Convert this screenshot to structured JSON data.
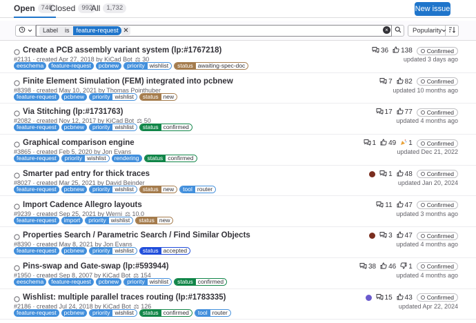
{
  "tabs": [
    {
      "label": "Open",
      "count": "740"
    },
    {
      "label": "Closed",
      "count": "992"
    },
    {
      "label": "All",
      "count": "1,732"
    }
  ],
  "new_issue_label": "New issue",
  "filter": {
    "token_key": "Label",
    "token_op": "is",
    "token_value": "feature-request",
    "sort_label": "Popularity"
  },
  "colors": {
    "blue_label": "#428fdc",
    "brown_label": "#a47b4c",
    "green_label": "#108548",
    "darkblue_label": "#1f4ddb",
    "accent": "#1f75cb"
  },
  "issues": [
    {
      "title": "Create a PCB assembly variant system (lp:#1767218)",
      "meta": "#2131 · created Apr 27, 2018 by KiCad Bot",
      "weight": "30",
      "labels": [
        {
          "k": "eeschema"
        },
        {
          "k": "feature-request"
        },
        {
          "k": "pcbnew"
        },
        {
          "k": "priority",
          "v": "wishlist"
        },
        {
          "k": "status",
          "v": "awaiting-spec-doc",
          "c": "brown"
        }
      ],
      "stats": [
        {
          "icon": "comment",
          "n": "36"
        },
        {
          "icon": "thumbsup",
          "n": "138"
        }
      ],
      "status": "Confirmed",
      "updated": "updated 3 days ago"
    },
    {
      "title": "Finite Element Simulation (FEM) integrated into pcbnew",
      "meta": "#8398 · created May 10, 2021 by Thomas Pointhuber",
      "weight": "",
      "labels": [
        {
          "k": "feature-request"
        },
        {
          "k": "pcbnew"
        },
        {
          "k": "priority",
          "v": "wishlist"
        },
        {
          "k": "status",
          "v": "new",
          "c": "brown"
        }
      ],
      "stats": [
        {
          "icon": "comment",
          "n": "7"
        },
        {
          "icon": "thumbsup",
          "n": "82"
        }
      ],
      "status": "Confirmed",
      "updated": "updated 10 months ago"
    },
    {
      "title": "Via Stitching (lp:#1731763)",
      "meta": "#2082 · created Nov 12, 2017 by KiCad Bot",
      "weight": "50",
      "labels": [
        {
          "k": "feature-request"
        },
        {
          "k": "pcbnew"
        },
        {
          "k": "priority",
          "v": "wishlist"
        },
        {
          "k": "status",
          "v": "confirmed",
          "c": "green"
        }
      ],
      "stats": [
        {
          "icon": "comment",
          "n": "17"
        },
        {
          "icon": "thumbsup",
          "n": "77"
        }
      ],
      "status": "Confirmed",
      "updated": "updated 4 months ago"
    },
    {
      "title": "Graphical comparison engine",
      "meta": "#3865 · created Feb 5, 2020 by Jon Evans",
      "weight": "",
      "labels": [
        {
          "k": "feature-request"
        },
        {
          "k": "priority",
          "v": "wishlist"
        },
        {
          "k": "rendering"
        },
        {
          "k": "status",
          "v": "confirmed",
          "c": "green"
        }
      ],
      "stats": [
        {
          "icon": "comment",
          "n": "1"
        },
        {
          "icon": "thumbsup",
          "n": "49"
        },
        {
          "icon": "tada",
          "n": "1"
        }
      ],
      "status": "Confirmed",
      "updated": "updated Dec 21, 2022"
    },
    {
      "title": "Smarter pad entry for thick traces",
      "meta": "#8027 · created Mar 25, 2021 by David Beinder",
      "weight": "",
      "labels": [
        {
          "k": "feature-request"
        },
        {
          "k": "pcbnew"
        },
        {
          "k": "priority",
          "v": "wishlist"
        },
        {
          "k": "status",
          "v": "new",
          "c": "brown"
        },
        {
          "k": "tool",
          "v": "router"
        }
      ],
      "avatar": "#7a2e1f",
      "stats": [
        {
          "icon": "comment",
          "n": "1"
        },
        {
          "icon": "thumbsup",
          "n": "48"
        }
      ],
      "status": "Confirmed",
      "updated": "updated Jan 20, 2024"
    },
    {
      "title": "Import Cadence Allegro layouts",
      "meta": "#9239 · created Sep 25, 2021 by Werni",
      "weight": "10.0",
      "labels": [
        {
          "k": "feature-request"
        },
        {
          "k": "import"
        },
        {
          "k": "priority",
          "v": "wishlist"
        },
        {
          "k": "status",
          "v": "new",
          "c": "brown"
        }
      ],
      "stats": [
        {
          "icon": "comment",
          "n": "11"
        },
        {
          "icon": "thumbsup",
          "n": "47"
        }
      ],
      "status": "Confirmed",
      "updated": "updated 3 months ago"
    },
    {
      "title": "Properties Search / Parametric Search / Find Similar Objects",
      "meta": "#8390 · created May 8, 2021 by Jon Evans",
      "weight": "",
      "labels": [
        {
          "k": "feature-request"
        },
        {
          "k": "pcbnew"
        },
        {
          "k": "priority",
          "v": "wishlist"
        },
        {
          "k": "status",
          "v": "accepted",
          "c": "darkblue"
        }
      ],
      "avatar": "#7a2e1f",
      "stats": [
        {
          "icon": "comment",
          "n": "3"
        },
        {
          "icon": "thumbsup",
          "n": "47"
        }
      ],
      "status": "Confirmed",
      "updated": "updated 4 months ago"
    },
    {
      "title": "Pins-swap and Gate-swap (lp:#593944)",
      "meta": "#1950 · created Sep 8, 2007 by KiCad Bot",
      "weight": "154",
      "labels": [
        {
          "k": "eeschema"
        },
        {
          "k": "feature-request"
        },
        {
          "k": "pcbnew"
        },
        {
          "k": "priority",
          "v": "wishlist"
        },
        {
          "k": "status",
          "v": "confirmed",
          "c": "green"
        }
      ],
      "stats": [
        {
          "icon": "comment",
          "n": "38"
        },
        {
          "icon": "thumbsup",
          "n": "46"
        },
        {
          "icon": "thumbsdown",
          "n": "1"
        }
      ],
      "status": "Confirmed",
      "updated": "updated 4 months ago"
    },
    {
      "title": "Wishlist: multiple parallel traces routing (lp:#1783335)",
      "meta": "#2186 · created Jul 24, 2018 by KiCad Bot",
      "weight": "126",
      "labels": [
        {
          "k": "feature-request"
        },
        {
          "k": "pcbnew"
        },
        {
          "k": "priority",
          "v": "wishlist"
        },
        {
          "k": "status",
          "v": "confirmed",
          "c": "green"
        },
        {
          "k": "tool",
          "v": "router"
        }
      ],
      "avatar": "#6a5acd",
      "stats": [
        {
          "icon": "comment",
          "n": "15"
        },
        {
          "icon": "thumbsup",
          "n": "43"
        }
      ],
      "status": "Confirmed",
      "updated": "updated Apr 22, 2024"
    }
  ]
}
